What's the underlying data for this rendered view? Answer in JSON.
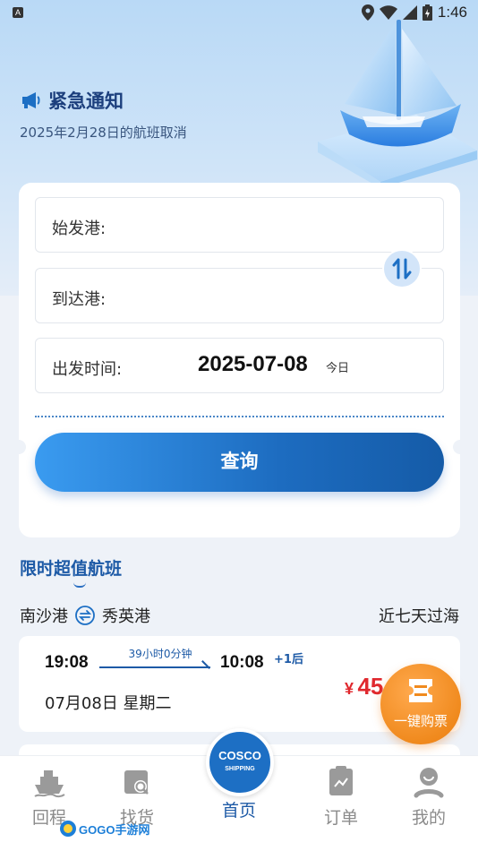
{
  "status_bar": {
    "indicator": "A",
    "time": "1:46"
  },
  "notice": {
    "title": "紧急通知",
    "subtitle": "2025年2月28日的航班取消"
  },
  "search": {
    "origin_label": "始发港:",
    "dest_label": "到达港:",
    "date_label": "出发时间:",
    "date_value": "2025-07-08",
    "today_label": "今日",
    "query_label": "查询"
  },
  "section": {
    "title": "限时超值航班",
    "route": {
      "from": "南沙港",
      "to": "秀英港"
    },
    "period": "近七天过海"
  },
  "trip": {
    "dep_time": "19:08",
    "duration": "39小时0分钟",
    "arr_time": "10:08",
    "next_day": "+1后",
    "date": "07月08日 星期二",
    "currency": "¥",
    "price": "45"
  },
  "fab": {
    "label": "一键购票"
  },
  "nav": {
    "items": [
      {
        "label": "回程",
        "icon": "ship-icon"
      },
      {
        "label": "找货",
        "icon": "cargo-search-icon"
      },
      {
        "label": "首页",
        "icon": "cosco-logo"
      },
      {
        "label": "订单",
        "icon": "order-clipboard-icon"
      },
      {
        "label": "我的",
        "icon": "user-icon"
      }
    ],
    "active": "首页"
  },
  "home_logo": {
    "line1": "COSCO",
    "line2": "SHIPPING"
  },
  "watermark": {
    "text": "GOGO手游网"
  },
  "colors": {
    "primary": "#1d5aa6",
    "accent": "#f08a1e",
    "price": "#e0282e"
  }
}
